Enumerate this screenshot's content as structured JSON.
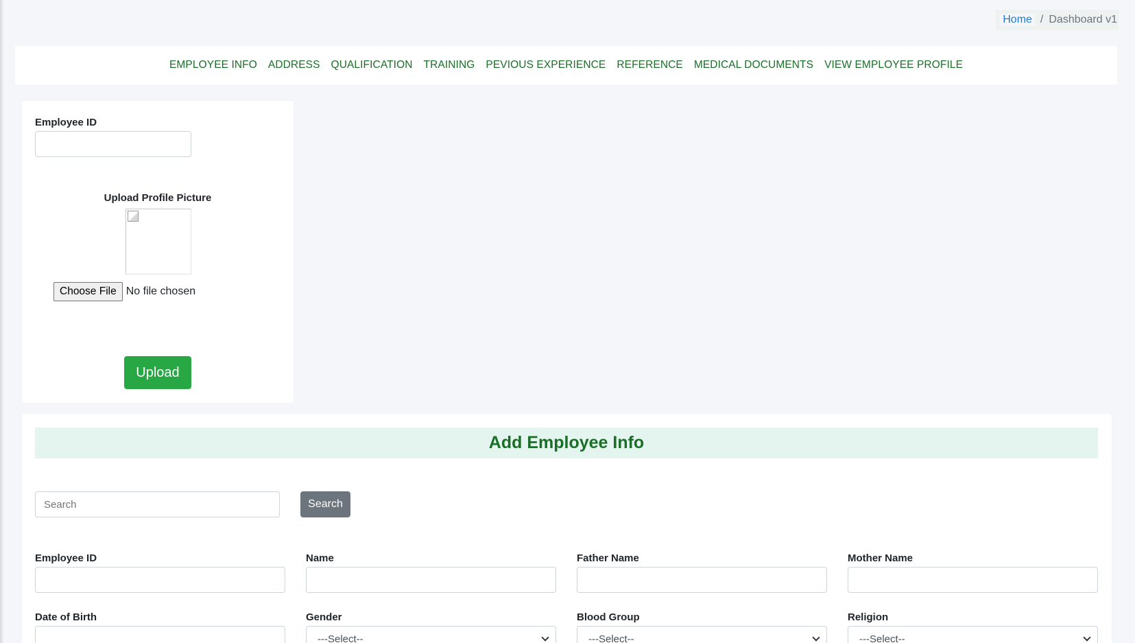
{
  "breadcrumb": {
    "home": "Home",
    "separator": "/",
    "current": "Dashboard v1"
  },
  "nav": {
    "items": [
      "EMPLOYEE INFO",
      "ADDRESS",
      "QUALIFICATION",
      "TRAINING",
      "PEVIOUS EXPERIENCE",
      "REFERENCE",
      "MEDICAL DOCUMENTS",
      "VIEW EMPLOYEE PROFILE"
    ]
  },
  "upload_card": {
    "employee_id_label": "Employee ID",
    "employee_id_value": "",
    "title": "Upload Profile Picture",
    "choose_file_label": "Choose File",
    "file_status": "No file chosen",
    "upload_label": "Upload"
  },
  "info_card": {
    "title": "Add Employee Info",
    "search_placeholder": "Search",
    "search_button": "Search",
    "fields": {
      "employee_id": "Employee ID",
      "name": "Name",
      "father_name": "Father Name",
      "mother_name": "Mother Name",
      "date_of_birth": "Date of Birth",
      "gender": "Gender",
      "blood_group": "Blood Group",
      "religion": "Religion"
    },
    "select_placeholder": "---Select--"
  },
  "colors": {
    "nav_text": "#1a6e28",
    "upload_button": "#28a745",
    "search_button": "#6c757d",
    "title_band": "#e3f5ee",
    "breadcrumb_link": "#1e7ad6"
  },
  "icons": {
    "broken_image": "broken-image-icon",
    "select_chevron": "chevron-down-icon"
  }
}
